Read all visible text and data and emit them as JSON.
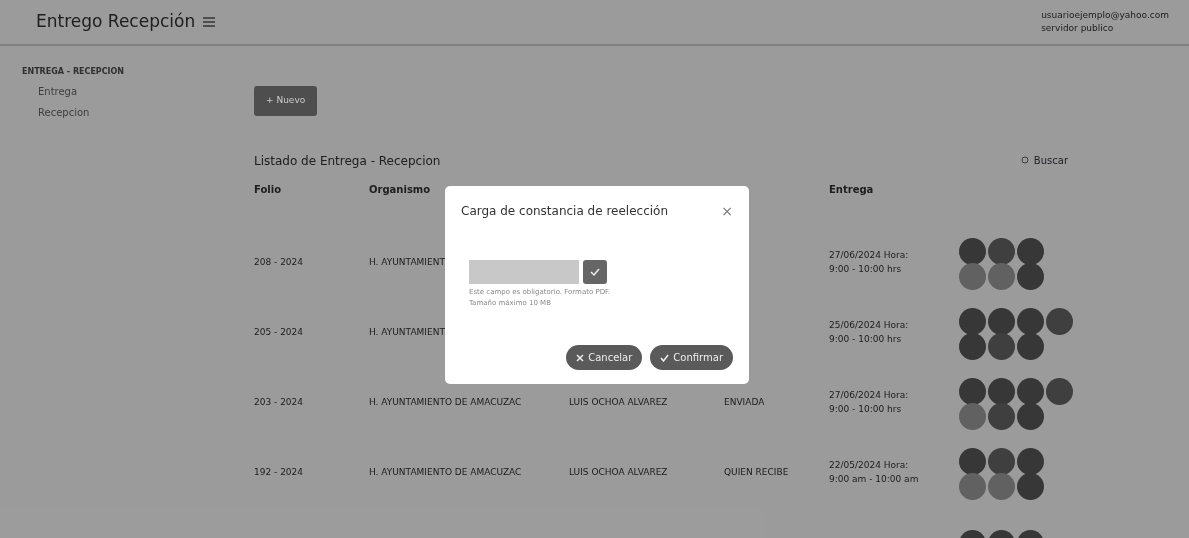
{
  "header": {
    "title": "Entrego Recepción",
    "user_email": "usuarioejemplo@yahoo.com",
    "user_role": "servidor publico"
  },
  "sidebar": {
    "section": "ENTREGA - RECEPCION",
    "items": [
      {
        "label": "Entrega",
        "selected": false
      },
      {
        "label": "Recepcion",
        "selected": false
      }
    ]
  },
  "new_button": "+ Nuevo",
  "list": {
    "title": "Listado de Entrega - Recepcion",
    "search_label": "Buscar",
    "columns": [
      "Folio",
      "Organismo",
      "Entrega"
    ],
    "rows": [
      {
        "folio": "208 - 2024",
        "organismo": "H. AYUNTAMIENT",
        "entrega": [
          "27/06/2024 Hora:",
          "9:00 - 10:00 hrs"
        ],
        "actions": [
          [
            {
              "color": "#3c3c3c"
            },
            {
              "color": "#454545"
            },
            {
              "color": "#3c3c3c"
            }
          ],
          [
            {
              "color": "#6a6a6a"
            },
            {
              "color": "#6a6a6a"
            },
            {
              "color": "#3c3c3c"
            }
          ]
        ]
      },
      {
        "folio": "205 - 2024",
        "organismo": "H. AYUNTAMIENT",
        "entrega": [
          "25/06/2024 Hora:",
          "9:00 - 10:00 hrs"
        ],
        "actions": [
          [
            {
              "color": "#3c3c3c"
            },
            {
              "color": "#3c3c3c"
            },
            {
              "color": "#3c3c3c"
            },
            {
              "color": "#454545"
            }
          ],
          [
            {
              "color": "#3c3c3c"
            },
            {
              "color": "#454545"
            },
            {
              "color": "#3c3c3c"
            }
          ]
        ]
      },
      {
        "folio": "203 - 2024",
        "organismo": "H. AYUNTAMIENTO DE AMACUZAC",
        "responsable": "LUIS OCHOA ALVAREZ",
        "estado": "ENVIADA",
        "entrega": [
          "27/06/2024 Hora:",
          "9:00 - 10:00 hrs"
        ],
        "actions": [
          [
            {
              "color": "#3c3c3c"
            },
            {
              "color": "#3c3c3c"
            },
            {
              "color": "#3c3c3c"
            },
            {
              "color": "#454545"
            }
          ],
          [
            {
              "color": "#6a6a6a"
            },
            {
              "color": "#454545"
            },
            {
              "color": "#3c3c3c"
            }
          ]
        ]
      },
      {
        "folio": "192 - 2024",
        "organismo": "H. AYUNTAMIENTO DE AMACUZAC",
        "responsable": "LUIS OCHOA ALVAREZ",
        "estado": "QUIEN RECIBE",
        "entrega": [
          "22/05/2024 Hora:",
          "9:00 am - 10:00 am"
        ],
        "actions": [
          [
            {
              "color": "#3c3c3c"
            },
            {
              "color": "#454545"
            },
            {
              "color": "#3c3c3c"
            }
          ],
          [
            {
              "color": "#6a6a6a"
            },
            {
              "color": "#6a6a6a"
            },
            {
              "color": "#3c3c3c"
            }
          ]
        ]
      },
      {
        "actions": [
          [
            {
              "color": "#3c3c3c"
            },
            {
              "color": "#3c3c3c"
            },
            {
              "color": "#3c3c3c"
            }
          ]
        ]
      }
    ]
  },
  "modal": {
    "title": "Carga de constancia de reelección",
    "close": "×",
    "help": [
      "Este campo es obligatorio. Formato PDF.",
      "Tamaño máximo 10 MB"
    ],
    "buttons": [
      {
        "kind": "cancel",
        "label": "Cancelar"
      },
      {
        "kind": "confirm",
        "label": "Confirmar"
      }
    ]
  }
}
